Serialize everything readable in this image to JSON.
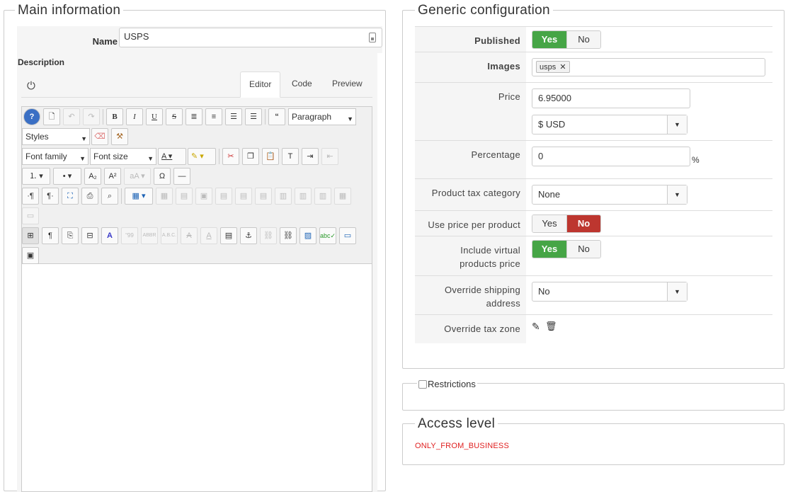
{
  "main": {
    "legend": "Main information",
    "name_label": "Name",
    "name_value": "USPS",
    "description_label": "Description",
    "tabs": [
      {
        "label": "Editor",
        "active": true
      },
      {
        "label": "Code",
        "active": false
      },
      {
        "label": "Preview",
        "active": false
      }
    ],
    "toolbar": {
      "format_select": "Paragraph",
      "styles_select": "Styles",
      "font_family_select": "Font family",
      "font_size_select": "Font size"
    }
  },
  "generic": {
    "legend": "Generic configuration",
    "published": {
      "label": "Published",
      "yes": "Yes",
      "no": "No",
      "selected": "yes"
    },
    "images": {
      "label": "Images",
      "tag": "usps"
    },
    "price": {
      "label": "Price",
      "value": "6.95000",
      "currency": "$ USD"
    },
    "percentage": {
      "label": "Percentage",
      "value": "0",
      "unit": "%"
    },
    "tax_category": {
      "label": "Product tax category",
      "value": "None"
    },
    "price_per_product": {
      "label": "Use price per product",
      "yes": "Yes",
      "no": "No",
      "selected": "no"
    },
    "virtual_products": {
      "label": "Include virtual products price",
      "yes": "Yes",
      "no": "No",
      "selected": "yes"
    },
    "shipping_address": {
      "label": "Override shipping address",
      "value": "No"
    },
    "tax_zone": {
      "label": "Override tax zone"
    }
  },
  "restrictions": {
    "label": "Restrictions"
  },
  "access": {
    "legend": "Access level",
    "value": "ONLY_FROM_BUSINESS"
  },
  "colors": {
    "green": "#46a546",
    "red": "#bd362f",
    "access_value": "#e02020"
  }
}
